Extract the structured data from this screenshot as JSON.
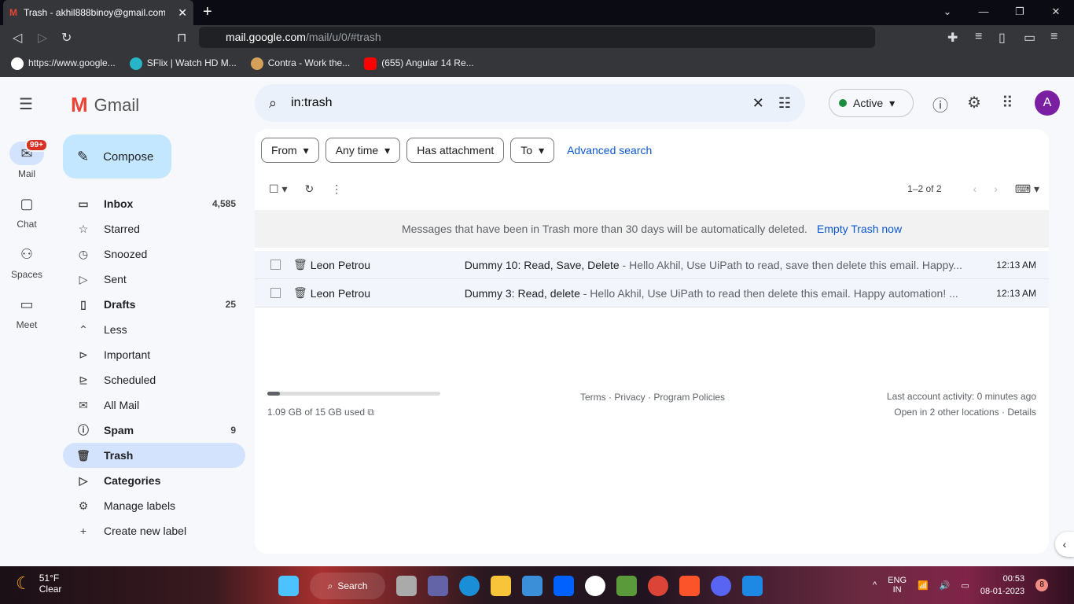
{
  "browser": {
    "tab_title": "Trash - akhil888binoy@gmail.com",
    "url_host": "mail.google.com",
    "url_path": "/mail/u/0/#trash",
    "bookmarks": [
      "https://www.google...",
      "SFlix | Watch HD M...",
      "Contra - Work the...",
      "(655) Angular 14 Re..."
    ]
  },
  "rail": {
    "mail": "Mail",
    "mail_badge": "99+",
    "chat": "Chat",
    "spaces": "Spaces",
    "meet": "Meet"
  },
  "app": {
    "name": "Gmail",
    "compose": "Compose"
  },
  "nav": [
    {
      "label": "Inbox",
      "count": "4,585",
      "icon": "inbox-icon",
      "g": "▭",
      "b": true
    },
    {
      "label": "Starred",
      "count": "",
      "icon": "star-icon",
      "g": "☆"
    },
    {
      "label": "Snoozed",
      "count": "",
      "icon": "clock-icon",
      "g": "◷"
    },
    {
      "label": "Sent",
      "count": "",
      "icon": "send-icon",
      "g": "▷"
    },
    {
      "label": "Drafts",
      "count": "25",
      "icon": "draft-icon",
      "g": "▯",
      "b": true
    },
    {
      "label": "Less",
      "count": "",
      "icon": "chevron-up-icon",
      "g": "⌃"
    },
    {
      "label": "Important",
      "count": "",
      "icon": "important-icon",
      "g": "⊳"
    },
    {
      "label": "Scheduled",
      "count": "",
      "icon": "scheduled-icon",
      "g": "⊵"
    },
    {
      "label": "All Mail",
      "count": "",
      "icon": "all-mail-icon",
      "g": "✉"
    },
    {
      "label": "Spam",
      "count": "9",
      "icon": "spam-icon",
      "g": "ⓘ",
      "b": true
    },
    {
      "label": "Trash",
      "count": "",
      "icon": "trash-icon",
      "g": "🗑",
      "b": true,
      "sel": true
    },
    {
      "label": "Categories",
      "count": "",
      "icon": "label-icon",
      "g": "▷",
      "b": true
    },
    {
      "label": "Manage labels",
      "count": "",
      "icon": "gear-icon",
      "g": "⚙"
    },
    {
      "label": "Create new label",
      "count": "",
      "icon": "plus-icon",
      "g": "+"
    }
  ],
  "search": {
    "value": "in:trash"
  },
  "status": "Active",
  "avatar": "A",
  "filters": {
    "from": "From",
    "time": "Any time",
    "attachment": "Has attachment",
    "to": "To",
    "advanced": "Advanced search"
  },
  "pagination": "1–2 of 2",
  "notice": {
    "text": "Messages that have been in Trash more than 30 days will be automatically deleted.",
    "action": "Empty Trash now"
  },
  "emails": [
    {
      "sender": "Leon Petrou",
      "subject": "Dummy 10: Read, Save, Delete",
      "snippet": " - Hello Akhil, Use UiPath to read, save then delete this email. Happy...",
      "time": "12:13 AM"
    },
    {
      "sender": "Leon Petrou",
      "subject": "Dummy 3: Read, delete",
      "snippet": " - Hello Akhil, Use UiPath to read then delete this email. Happy automation! ...",
      "time": "12:13 AM"
    }
  ],
  "footer": {
    "storage": "1.09 GB of 15 GB used",
    "storage_fraction": 0.073,
    "links": "Terms · Privacy · Program Policies",
    "activity": "Last account activity: 0 minutes ago",
    "locations": "Open in 2 other locations · Details"
  },
  "taskbar": {
    "temp": "51°F",
    "weather": "Clear",
    "search": "Search",
    "lang1": "ENG",
    "lang2": "IN",
    "time": "00:53",
    "date": "08-01-2023",
    "notif": "8"
  }
}
